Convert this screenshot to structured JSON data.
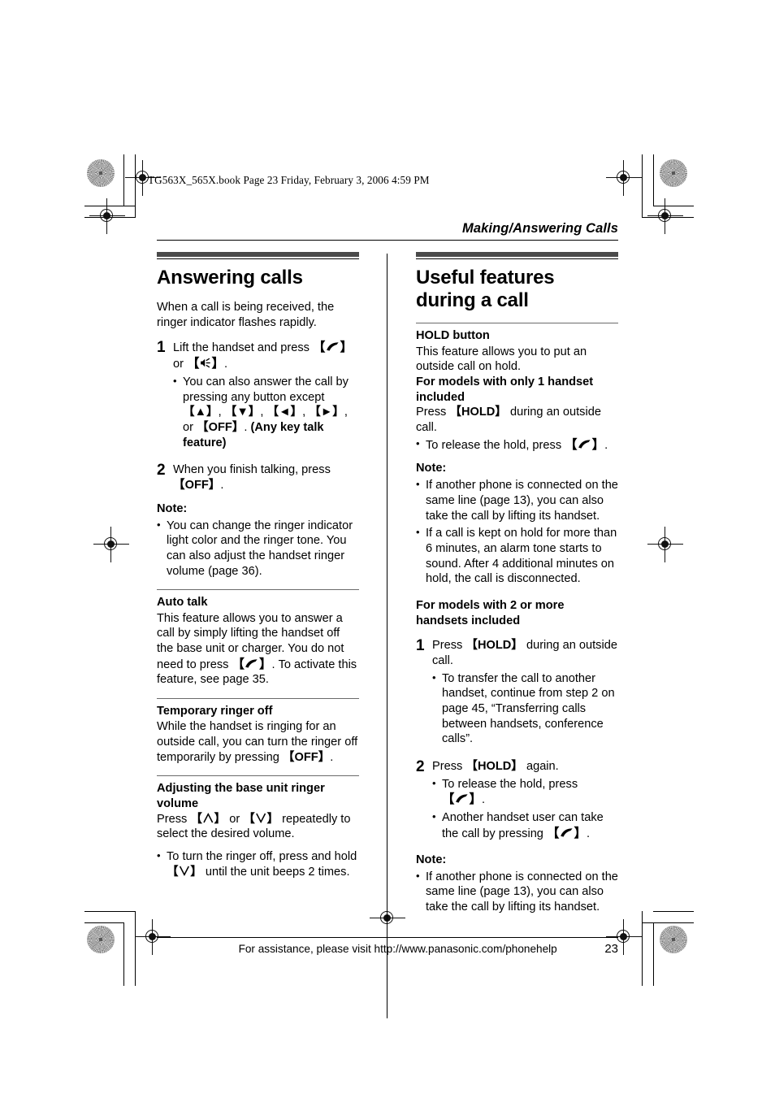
{
  "file_header": "TG563X_565X.book  Page 23  Friday, February 3, 2006  4:59 PM",
  "running_head": "Making/Answering Calls",
  "left_column": {
    "section_title": "Answering calls",
    "intro": "When a call is being received, the ringer indicator flashes rapidly.",
    "step1": {
      "number": "1",
      "text_before": "Lift the handset and press ",
      "key_talk": "【",
      "or": " or ",
      "text_after": ".",
      "bullet": {
        "part1": "You can also answer the call by pressing any button except ",
        "keys": [
          "【▲】",
          "【▼】",
          "【◄】",
          "【►】"
        ],
        "part2": ", or ",
        "key_off": "【OFF】",
        "part3": ". ",
        "bold_tail": "(Any key talk feature)"
      }
    },
    "step2": {
      "number": "2",
      "text_before": "When you finish talking, press ",
      "key_off": "【OFF】",
      "text_after": "."
    },
    "note_label": "Note:",
    "note_bullet": "You can change the ringer indicator light color and the ringer tone. You can also adjust the handset ringer volume (page 36).",
    "auto_talk": {
      "heading": "Auto talk",
      "text_before": "This feature allows you to answer a call by simply lifting the handset off the base unit or charger. You do not need to press ",
      "text_after": ". To activate this feature, see page 35."
    },
    "temporary_ringer_off": {
      "heading": "Temporary ringer off",
      "text_before": "While the handset is ringing for an outside call, you can turn the ringer off temporarily by pressing ",
      "key_off": "【OFF】",
      "text_after": "."
    },
    "base_ringer_volume": {
      "heading": "Adjusting the base unit ringer volume",
      "press": "Press ",
      "key_up": "【∧】",
      "or": " or ",
      "key_down": "【∨】",
      "tail": " repeatedly to select the desired volume.",
      "bullet_part1": "To turn the ringer off, press and hold ",
      "bullet_key": "【∨】",
      "bullet_part2": " until the unit beeps 2 times."
    }
  },
  "right_column": {
    "section_title": "Useful features during a call",
    "hold_button": {
      "heading": "HOLD button",
      "intro": "This feature allows you to put an outside call on hold.",
      "models_1_heading": "For models with only 1 handset included",
      "press_before": "Press ",
      "key_hold": "【HOLD】",
      "press_after": " during an outside call.",
      "bullet_before": "To release the hold, press ",
      "bullet_after": "."
    },
    "note1_label": "Note:",
    "note1_bullets": [
      "If another phone is connected on the same line (page 13), you can also take the call by lifting its handset.",
      "If a call is kept on hold for more than 6 minutes, an alarm tone starts to sound. After 4 additional minutes on hold, the call is disconnected."
    ],
    "models_2_heading": "For models with 2 or more handsets included",
    "step1": {
      "number": "1",
      "text_before": "Press ",
      "key_hold": "【HOLD】",
      "text_after": " during an outside call.",
      "bullet": "To transfer the call to another handset, continue from step 2 on page 45, “Transferring calls between handsets, conference calls”."
    },
    "step2": {
      "number": "2",
      "text_before": "Press ",
      "key_hold": "【HOLD】",
      "text_after": " again.",
      "bullet1_before": "To release the hold, press ",
      "bullet1_after": ".",
      "bullet2_before": "Another handset user can take the call by pressing ",
      "bullet2_after": "."
    },
    "note2_label": "Note:",
    "note2_bullet": "If another phone is connected on the same line (page 13), you can also take the call by lifting its handset."
  },
  "footer": {
    "text": "For assistance, please visit http://www.panasonic.com/phonehelp",
    "page_number": "23"
  },
  "icons": {
    "talk": "talk-handset-icon",
    "speakerphone": "speakerphone-icon",
    "bullet": "•"
  },
  "colors": {
    "rule_bar": "#4a4a4a",
    "text": "#000000",
    "sub_rule": "#6b6b6b"
  }
}
